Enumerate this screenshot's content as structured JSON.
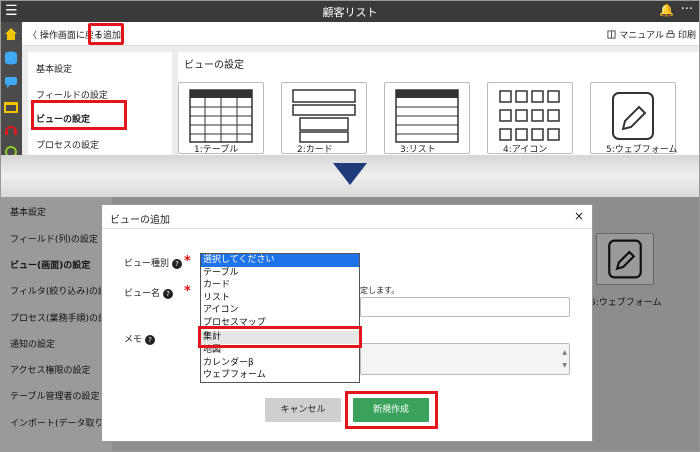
{
  "topbar": {
    "title": "顧客リスト",
    "menu_glyph": "☰",
    "bell_glyph": "🔔",
    "more_glyph": "···"
  },
  "toolbar": {
    "back": "〈 操作画面に戻る",
    "add": "＋追加",
    "manual": "マニュアル",
    "print": "印刷"
  },
  "side_menu": [
    "基本設定",
    "フィールドの設定",
    "ビューの設定",
    "プロセスの設定"
  ],
  "views_panel": {
    "title": "ビューの設定",
    "cards": [
      "1:テーブル",
      "2:カード",
      "3:リスト",
      "4:アイコン",
      "5:ウェブフォーム"
    ]
  },
  "lower_side_menu": [
    "基本設定",
    "フィールド(列)の設定",
    "ビュー(画面)の設定",
    "フィルタ(絞り込み)の設",
    "プロセス(業務手順)の設",
    "通知の設定",
    "アクセス権限の設定",
    "テーブル管理者の設定",
    "インポート(データ取り"
  ],
  "lower_right_label": "5:ウェブフォーム",
  "modal": {
    "title": "ビューの追加",
    "close": "×",
    "view_type_label": "ビュー種別",
    "view_name_label": "ビュー名",
    "memo_label": "メモ",
    "required_mark": "*",
    "help_mark": "?",
    "name_hint": "定します。",
    "options": [
      "選択してください",
      "テーブル",
      "カード",
      "リスト",
      "アイコン",
      "プロセスマップ",
      "集計",
      "地図",
      "カレンダーβ",
      "ウェブフォーム"
    ],
    "selected_index": 0,
    "highlighted_index": 6,
    "cancel": "キャンセル",
    "create": "新規作成"
  },
  "colors": {
    "highlight": "#e4141b",
    "create_button": "#3aa25a",
    "selected_option": "#1e73e8",
    "arrow": "#1f3b7a"
  }
}
